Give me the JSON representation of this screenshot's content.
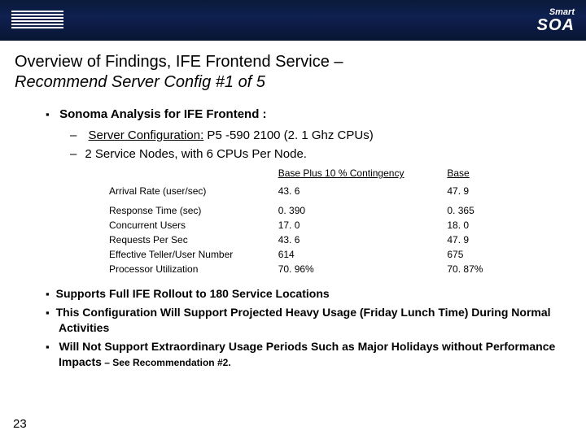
{
  "header": {
    "logo_alt": "IBM",
    "badge_small": "Smart",
    "badge_big": "SOA"
  },
  "title_line1": "Overview of Findings, IFE Frontend Service –",
  "title_line2": "Recommend Server Config #1 of 5",
  "analysis_heading": "Sonoma Analysis for IFE Frontend",
  "server_cfg_label": "Server Configuration:",
  "server_cfg_value": "  P5 -590 2100 (2. 1 Ghz CPUs)",
  "nodes_line": "2 Service Nodes, with 6 CPUs Per Node.",
  "table": {
    "col_plus": "Base Plus 10 % Contingency",
    "col_base": "Base",
    "rows": [
      {
        "label": "Arrival Rate (user/sec)",
        "plus": "43. 6",
        "base": "47. 9"
      },
      {
        "label": "Response Time (sec)",
        "plus": "0. 390",
        "base": "0. 365"
      },
      {
        "label": "Concurrent Users",
        "plus": "17. 0",
        "base": "18. 0"
      },
      {
        "label": "Requests Per Sec",
        "plus": "43. 6",
        "base": "47. 9"
      },
      {
        "label": "Effective Teller/User Number",
        "plus": "614",
        "base": "675"
      },
      {
        "label": "Processor Utilization",
        "plus": "70. 96%",
        "base": "70. 87%"
      }
    ]
  },
  "bullets": {
    "b1": "Supports Full IFE Rollout to 180 Service Locations",
    "b2": "This Configuration Will Support Projected Heavy Usage (Friday Lunch Time) During Normal Activities",
    "b3_main": "Will Not Support Extraordinary Usage Periods Such as Major Holidays without Performance Impacts",
    "b3_see": " – See Recommendation #2."
  },
  "page_number": "23"
}
